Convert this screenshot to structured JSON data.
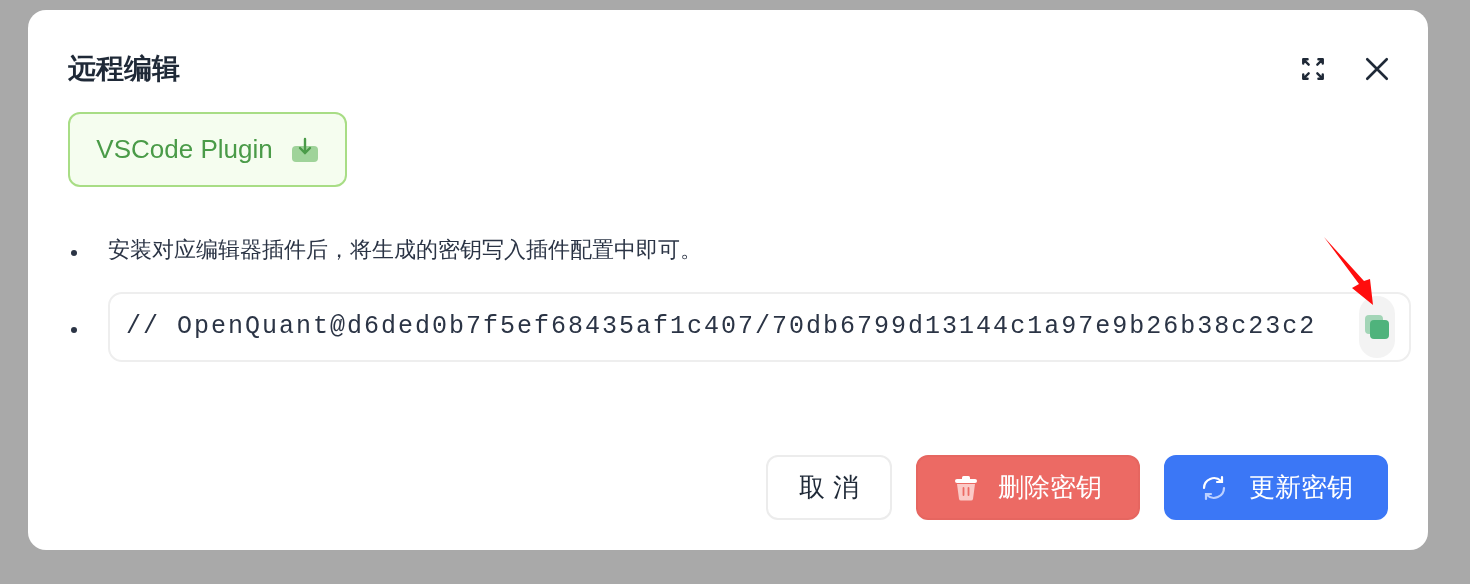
{
  "dialog": {
    "title": "远程编辑",
    "plugin_button": {
      "label": "VSCode Plugin"
    },
    "items": [
      {
        "kind": "text",
        "text": "安装对应编辑器插件后，将生成的密钥写入插件配置中即可。"
      },
      {
        "kind": "code",
        "text": "// OpenQuant@d6ded0b7f5ef68435af1c407/70db6799d13144c1a97e9b26b38c23c2"
      }
    ],
    "buttons": [
      {
        "kind": "cancel",
        "label": "取 消"
      },
      {
        "kind": "delete",
        "label": "删除密钥"
      },
      {
        "kind": "update",
        "label": "更新密钥"
      }
    ]
  }
}
